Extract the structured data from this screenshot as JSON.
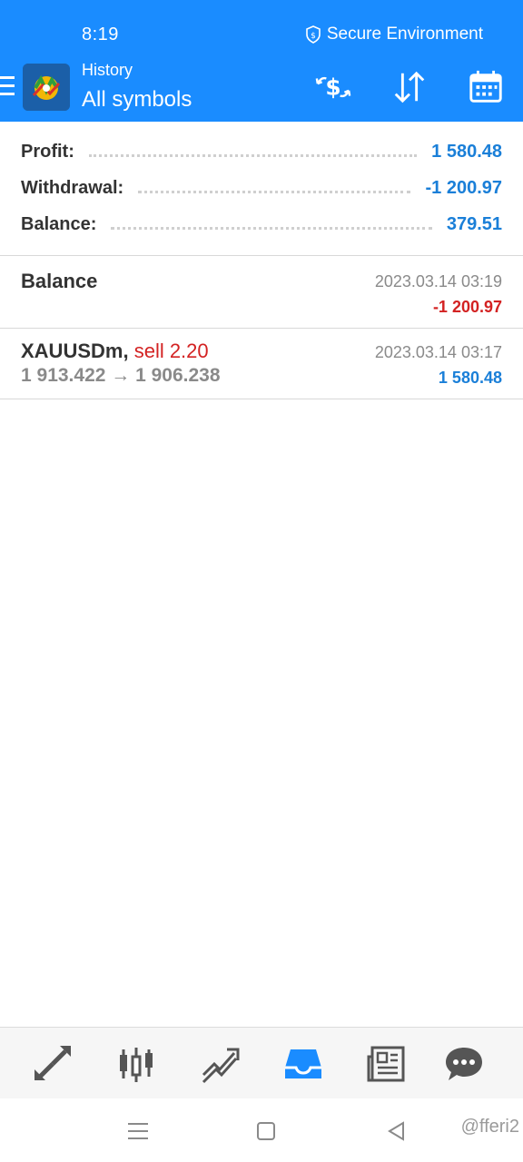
{
  "status_bar": {
    "time": "8:19",
    "secure_label": "Secure Environment"
  },
  "header": {
    "subtitle": "History",
    "title": "All symbols",
    "icons": [
      "deposit-withdraw-icon",
      "sort-icon",
      "calendar-icon"
    ]
  },
  "colors": {
    "header_bg": "#1a8cff",
    "positive": "#1a7fd8",
    "negative": "#d32222"
  },
  "summary": [
    {
      "label": "Profit:",
      "value": "1 580.48"
    },
    {
      "label": "Withdrawal:",
      "value": "-1 200.97"
    },
    {
      "label": "Balance:",
      "value": "379.51"
    }
  ],
  "deals": [
    {
      "title": "Balance",
      "date": "2023.03.14 03:19",
      "amount": "-1 200.97"
    },
    {
      "symbol": "XAUUSDm,",
      "side": "sell 2.20",
      "prices": "1 913.422 → 1 906.238",
      "date": "2023.03.14 03:17",
      "amount": "1 580.48"
    }
  ],
  "bottom_nav": [
    "quotes-icon",
    "chart-icon",
    "trade-icon",
    "history-icon",
    "news-icon",
    "chat-icon"
  ],
  "watermark": "@fferi2"
}
